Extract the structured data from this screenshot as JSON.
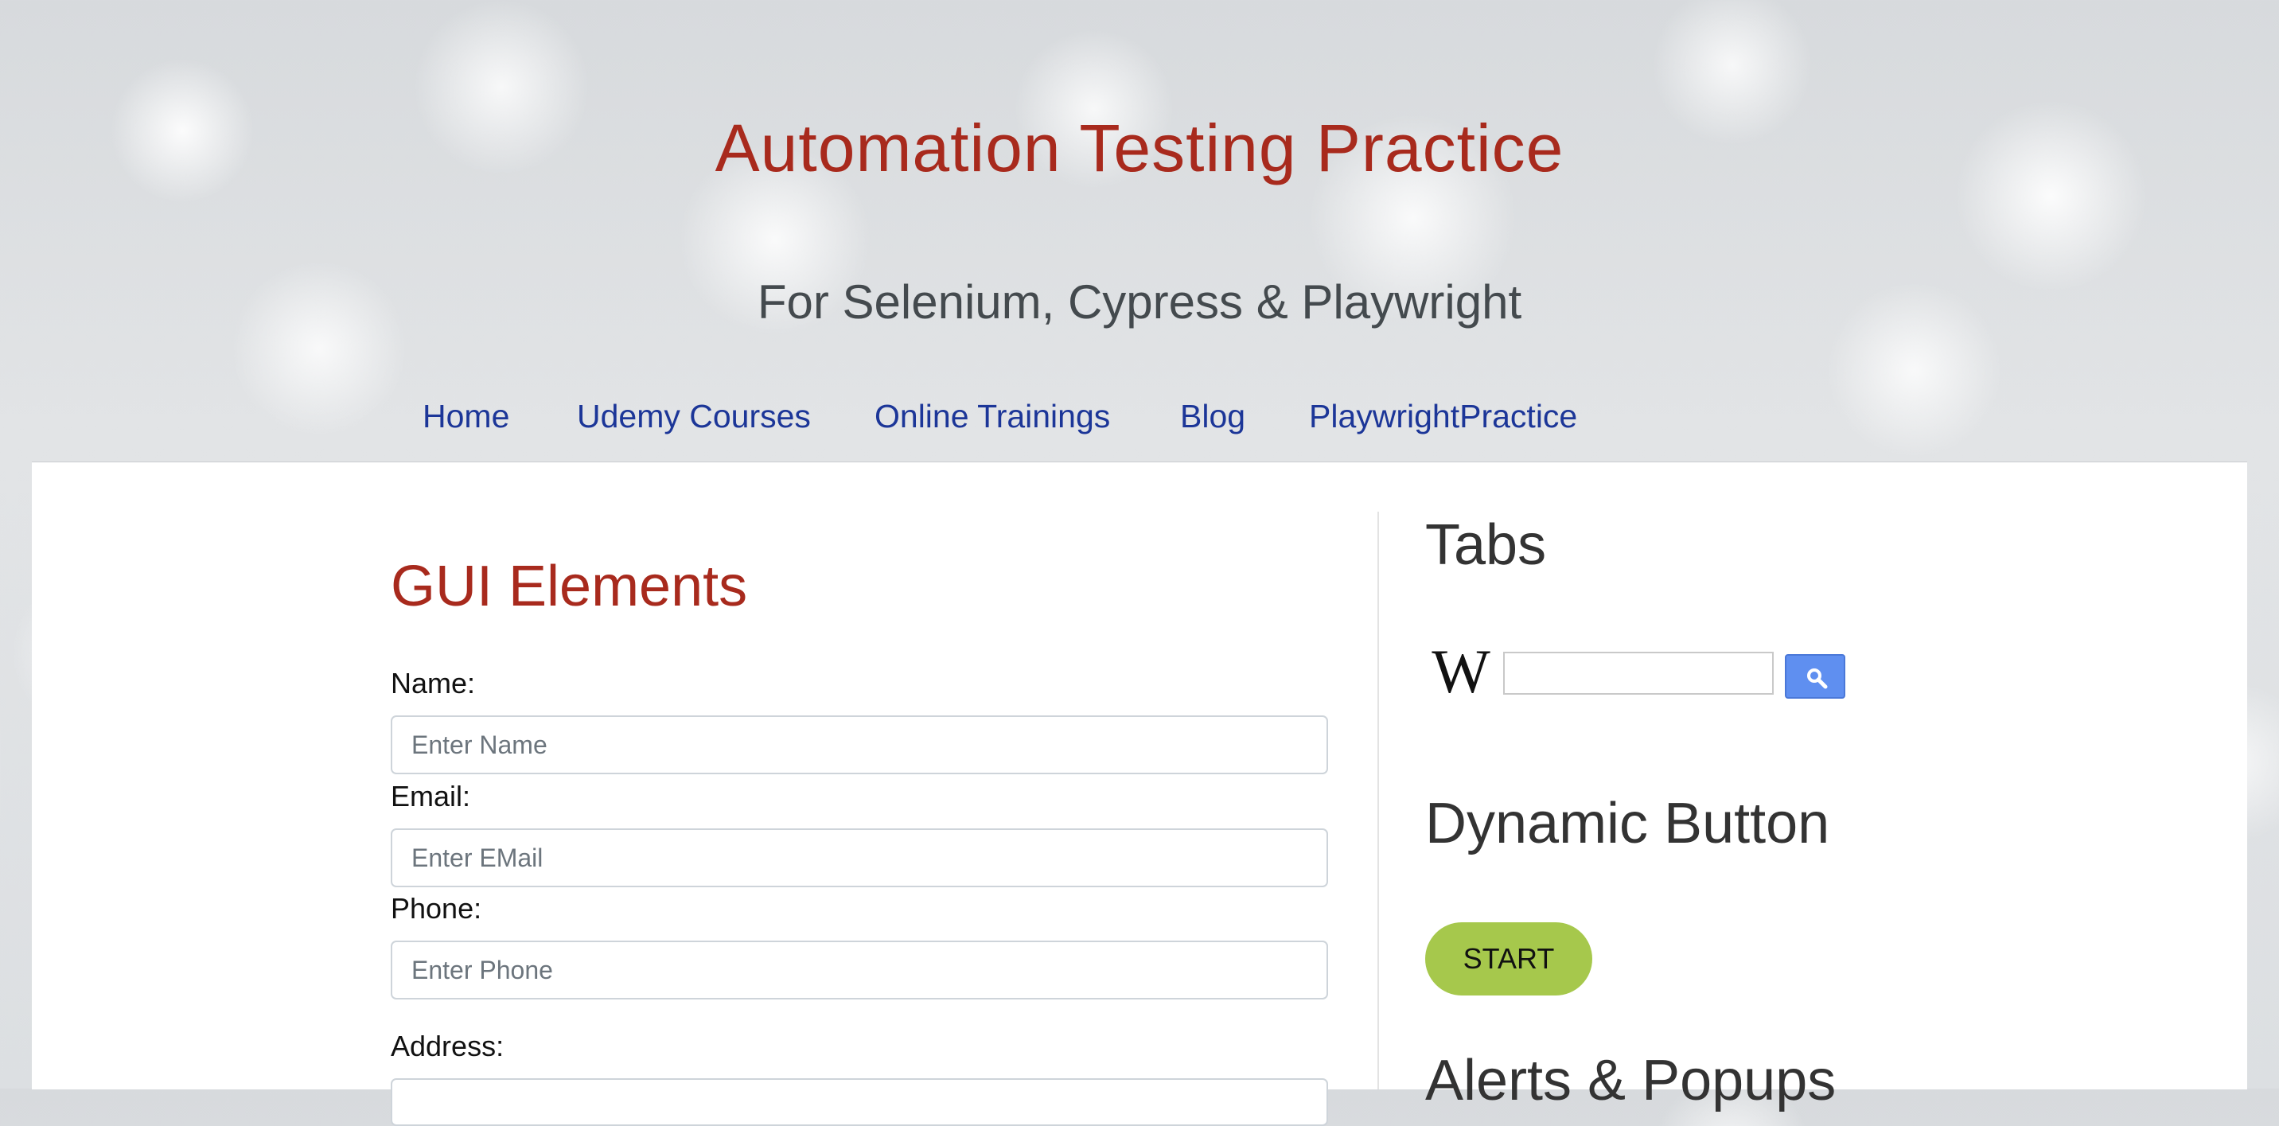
{
  "header": {
    "title": "Automation Testing Practice",
    "subtitle": "For Selenium, Cypress & Playwright"
  },
  "nav": {
    "items": [
      {
        "label": "Home"
      },
      {
        "label": "Udemy Courses"
      },
      {
        "label": "Online Trainings"
      },
      {
        "label": "Blog"
      },
      {
        "label": "PlaywrightPractice"
      }
    ]
  },
  "gui": {
    "title": "GUI Elements",
    "name_label": "Name:",
    "name_placeholder": "Enter Name",
    "email_label": "Email:",
    "email_placeholder": "Enter EMail",
    "phone_label": "Phone:",
    "phone_placeholder": "Enter Phone",
    "address_label": "Address:"
  },
  "sidebar": {
    "tabs_title": "Tabs",
    "wiki_logo": "W",
    "wiki_search_icon": "search-icon",
    "dynamic_title": "Dynamic Button",
    "start_label": "START",
    "alerts_title": "Alerts & Popups"
  },
  "colors": {
    "title_red": "#a82a1d",
    "nav_blue": "#1c3698",
    "start_green": "#a6c84c",
    "wiki_blue": "#5f8ff0"
  }
}
